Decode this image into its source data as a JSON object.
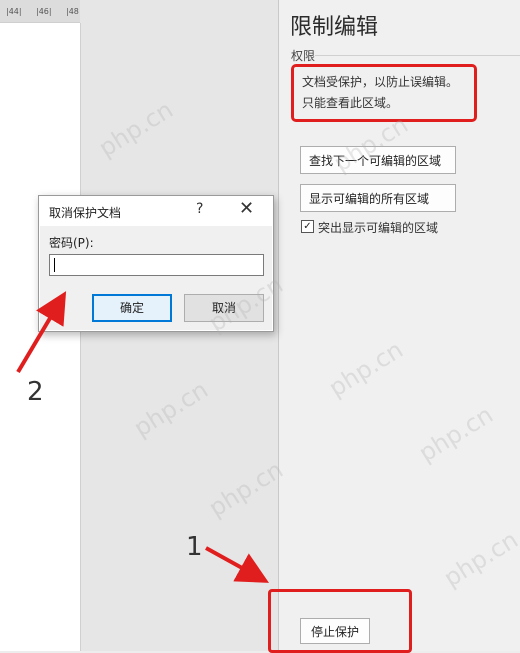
{
  "ruler": {
    "marks": [
      "|44|",
      "|46|",
      "|48"
    ]
  },
  "pane": {
    "title": "限制编辑",
    "section": "权限",
    "notice_line1": "文档受保护，以防止误编辑。",
    "notice_line2": "只能查看此区域。",
    "find_next_button": "查找下一个可编辑的区域",
    "show_all_button": "显示可编辑的所有区域",
    "highlight_checkbox": {
      "label": "突出显示可编辑的区域",
      "checked": true,
      "mark": "✓"
    },
    "stop_button": "停止保护"
  },
  "dialog": {
    "title": "取消保护文档",
    "help": "?",
    "close": "✕",
    "password_label": "密码(P):",
    "password_value": "",
    "ok_button": "确定",
    "cancel_button": "取消"
  },
  "annotations": {
    "step1": "1",
    "step2": "2"
  },
  "watermark": "php.cn",
  "colors": {
    "highlight_red": "#e01e1e",
    "default_button_border": "#0078d7"
  }
}
